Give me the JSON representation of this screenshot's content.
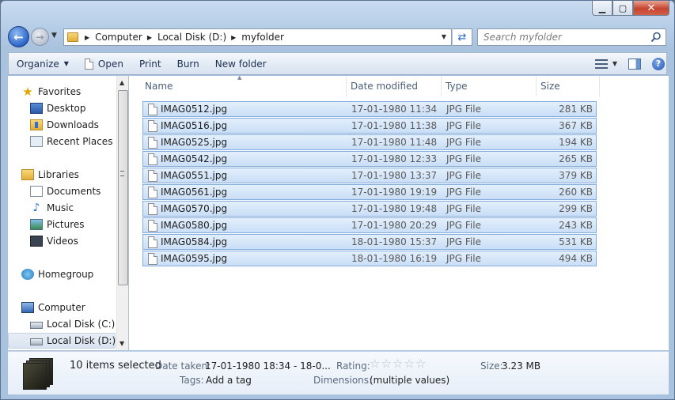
{
  "address": {
    "crumbs": [
      "Computer",
      "Local Disk (D:)",
      "myfolder"
    ],
    "search_placeholder": "Search myfolder"
  },
  "toolbar": {
    "organize": "Organize",
    "open": "Open",
    "print": "Print",
    "burn": "Burn",
    "new_folder": "New folder"
  },
  "nav": {
    "favorites": "Favorites",
    "desktop": "Desktop",
    "downloads": "Downloads",
    "recent": "Recent Places",
    "libraries": "Libraries",
    "documents": "Documents",
    "music": "Music",
    "pictures": "Pictures",
    "videos": "Videos",
    "homegroup": "Homegroup",
    "computer": "Computer",
    "disk_c": "Local Disk (C:)",
    "disk_d": "Local Disk (D:)"
  },
  "columns": {
    "name": "Name",
    "date": "Date modified",
    "type": "Type",
    "size": "Size"
  },
  "files": [
    {
      "name": "IMAG0512.jpg",
      "date": "17-01-1980 11:34",
      "type": "JPG File",
      "size": "281 KB"
    },
    {
      "name": "IMAG0516.jpg",
      "date": "17-01-1980 11:38",
      "type": "JPG File",
      "size": "367 KB"
    },
    {
      "name": "IMAG0525.jpg",
      "date": "17-01-1980 11:48",
      "type": "JPG File",
      "size": "194 KB"
    },
    {
      "name": "IMAG0542.jpg",
      "date": "17-01-1980 12:33",
      "type": "JPG File",
      "size": "265 KB"
    },
    {
      "name": "IMAG0551.jpg",
      "date": "17-01-1980 13:37",
      "type": "JPG File",
      "size": "379 KB"
    },
    {
      "name": "IMAG0561.jpg",
      "date": "17-01-1980 19:19",
      "type": "JPG File",
      "size": "260 KB"
    },
    {
      "name": "IMAG0570.jpg",
      "date": "17-01-1980 19:48",
      "type": "JPG File",
      "size": "299 KB"
    },
    {
      "name": "IMAG0580.jpg",
      "date": "17-01-1980 20:29",
      "type": "JPG File",
      "size": "243 KB"
    },
    {
      "name": "IMAG0584.jpg",
      "date": "18-01-1980 15:37",
      "type": "JPG File",
      "size": "531 KB"
    },
    {
      "name": "IMAG0595.jpg",
      "date": "18-01-1980 16:19",
      "type": "JPG File",
      "size": "494 KB"
    }
  ],
  "details": {
    "selected": "10 items selected",
    "date_taken_label": "Date taken:",
    "date_taken_value": "17-01-1980 18:34 - 18-0...",
    "tags_label": "Tags:",
    "tags_value": "Add a tag",
    "rating_label": "Rating:",
    "rating_value": 0,
    "dimensions_label": "Dimensions:",
    "dimensions_value": "(multiple values)",
    "size_label": "Size:",
    "size_value": "3.23 MB"
  }
}
